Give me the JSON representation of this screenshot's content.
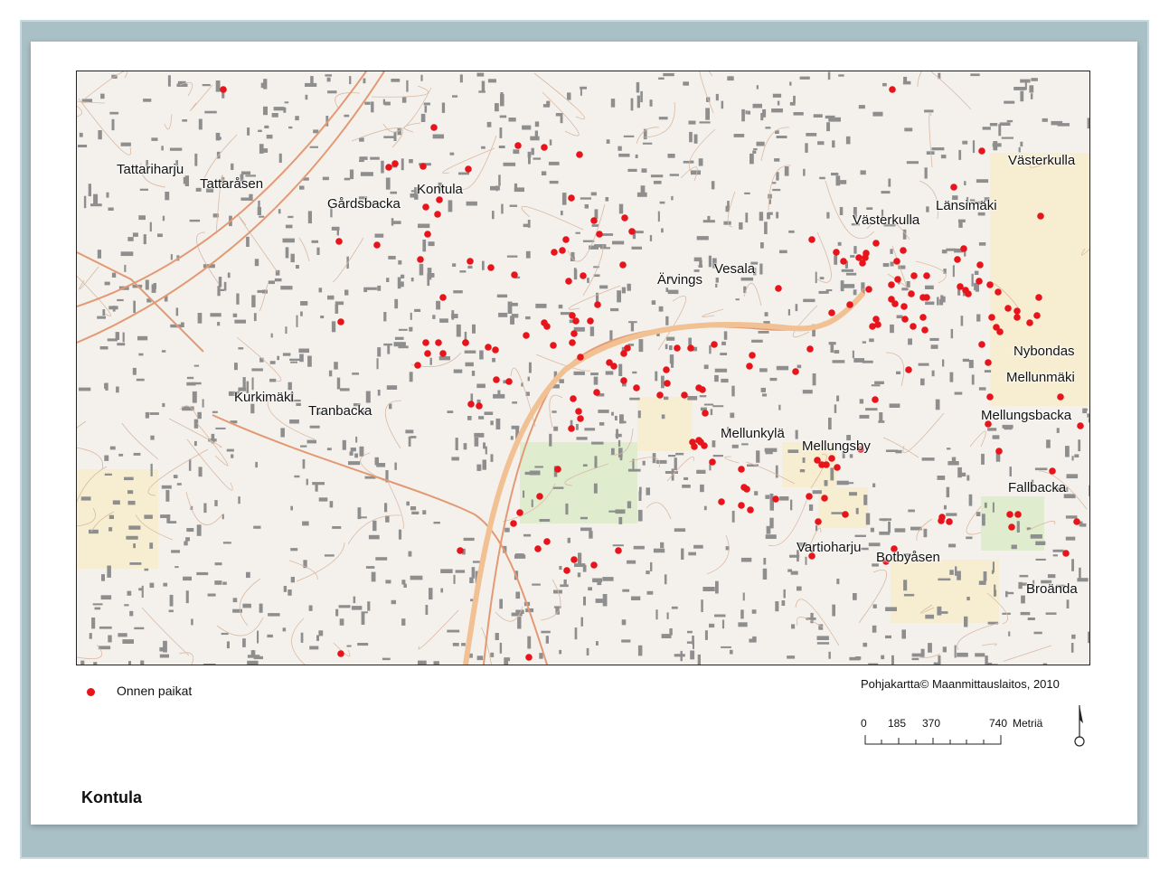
{
  "title": "Kontula",
  "legend": {
    "label": "Onnen paikat",
    "color": "#e8141b"
  },
  "credit": "Pohjakartta© Maanmittauslaitos,  2010",
  "scale": {
    "ticks": [
      "0",
      "185",
      "370",
      "740"
    ],
    "unit": "Metriä"
  },
  "colors": {
    "point": "#e8141b",
    "road": "#e39a74",
    "building": "#8e8e8e",
    "water": "#f7eed2",
    "park": "#dfeccd"
  },
  "places": [
    {
      "name": "Tattariharju"
    },
    {
      "name": "Tattaråsen"
    },
    {
      "name": "Gårdsbacka"
    },
    {
      "name": "Kontula"
    },
    {
      "name": "Västerkulla"
    },
    {
      "name": "Länsimäki"
    },
    {
      "name": "Västerkulla"
    },
    {
      "name": "Vesala"
    },
    {
      "name": "Ärvings"
    },
    {
      "name": "Nybondas"
    },
    {
      "name": "Mellunmäki"
    },
    {
      "name": "Mellungsbacka"
    },
    {
      "name": "Kurkimäki"
    },
    {
      "name": "Tranbacka"
    },
    {
      "name": "Mellunkylä"
    },
    {
      "name": "Mellungsby"
    },
    {
      "name": "Fallbacka"
    },
    {
      "name": "Vartioharju"
    },
    {
      "name": "Botbyåsen"
    },
    {
      "name": "Broända"
    }
  ]
}
